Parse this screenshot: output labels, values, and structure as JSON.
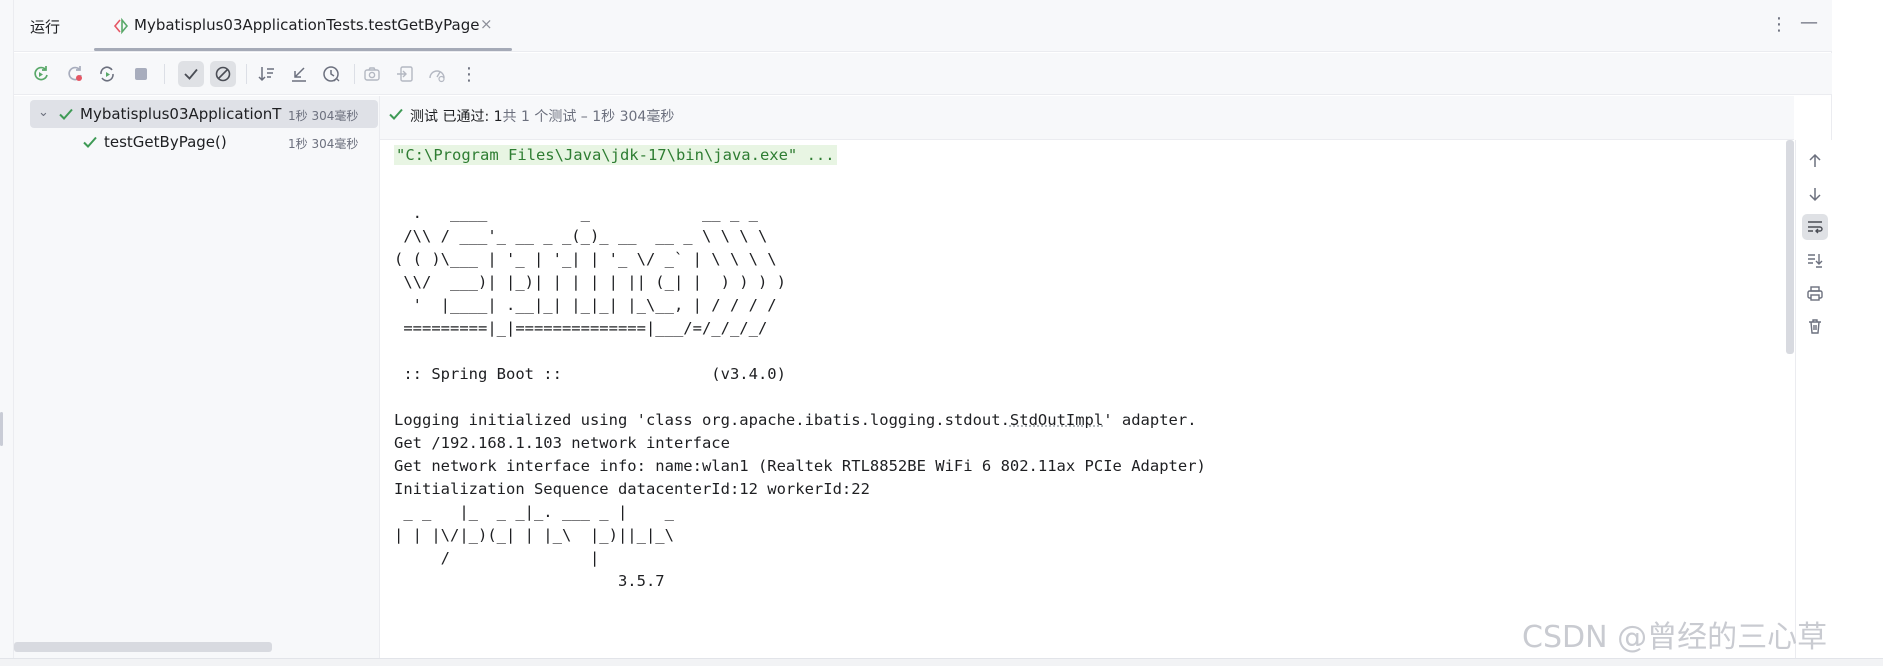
{
  "header": {
    "run_title": "运行",
    "tab_label": "Mybatisplus03ApplicationTests.testGetByPage",
    "tab_close": "×",
    "more": "⋮",
    "minimize": "—"
  },
  "toolbar": {
    "more": "⋮"
  },
  "tree": {
    "items": [
      {
        "label": "Mybatisplus03ApplicationT",
        "duration": "1秒 304毫秒"
      },
      {
        "label": "testGetByPage()",
        "duration": "1秒 304毫秒"
      }
    ]
  },
  "status": {
    "prefix": "测试 已通过: 1",
    "suffix": "共 1 个测试 – 1秒 304毫秒"
  },
  "console": {
    "command": "\"C:\\Program Files\\Java\\jdk-17\\bin\\java.exe\" ...",
    "banner": [
      "  .   ____          _            __ _ _",
      " /\\\\ / ___'_ __ _ _(_)_ __  __ _ \\ \\ \\ \\",
      "( ( )\\___ | '_ | '_| | '_ \\/ _` | \\ \\ \\ \\",
      " \\\\/  ___)| |_)| | | | | || (_| |  ) ) ) )",
      "  '  |____| .__|_| |_|_| |_\\__, | / / / /",
      " =========|_|==============|___/=/_/_/_/"
    ],
    "spring_boot": " :: Spring Boot ::                (v3.4.0)",
    "logging_before": "Logging initialized using 'class org.apache.ibatis.logging.stdout.",
    "logging_link": "StdOutImpl",
    "logging_after": "' adapter.",
    "lines": [
      "Get /192.168.1.103 network interface",
      "Get network interface info: name:wlan1 (Realtek RTL8852BE WiFi 6 802.11ax PCIe Adapter)",
      "Initialization Sequence datacenterId:12 workerId:22"
    ],
    "mp_banner": [
      " _ _   |_  _ _|_. ___ _ |    _",
      "| | |\\/|_)(_| | |_\\  |_)||_|_\\",
      "     /               |",
      "                        3.5.7"
    ]
  },
  "watermark": "CSDN @曾经的三心草"
}
